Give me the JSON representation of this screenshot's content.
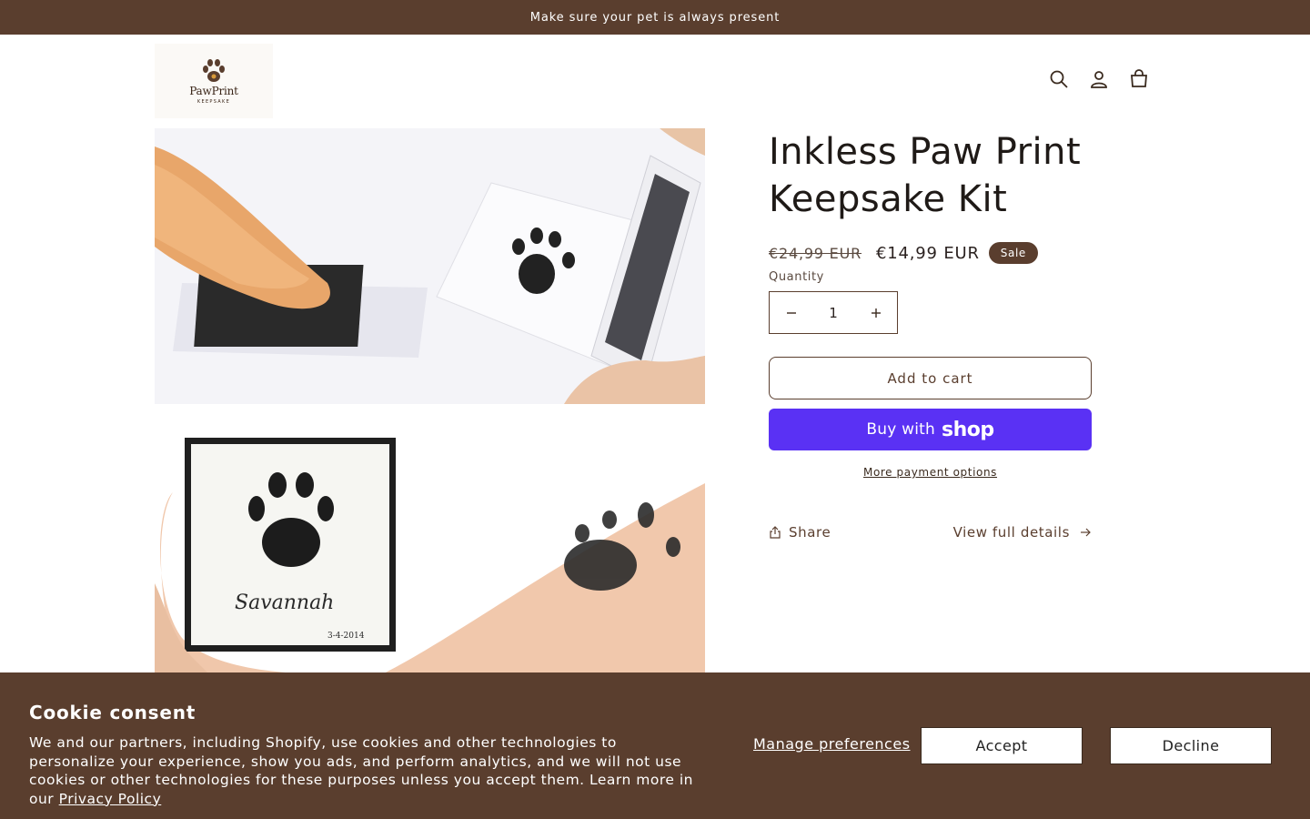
{
  "announcement": {
    "text": "Make sure your pet is always present"
  },
  "header": {
    "logo": {
      "name": "PawPrint",
      "subtitle": "KEEPSAKE"
    },
    "icons": [
      "search-icon",
      "account-icon",
      "cart-icon"
    ]
  },
  "gallery": {
    "image_text": {
      "name": "Savannah",
      "date": "3-4-2014"
    }
  },
  "product": {
    "title": "Inkless Paw Print Keepsake Kit",
    "price_regular": "€24,99 EUR",
    "price_sale": "€14,99 EUR",
    "badge": "Sale",
    "quantity_label": "Quantity",
    "quantity_value": "1",
    "add_to_cart": "Add to cart",
    "buy_with": "Buy with",
    "shop_brand": "shop",
    "more_payment": "More payment options",
    "share": "Share",
    "view_details": "View full details"
  },
  "cookie": {
    "title": "Cookie consent",
    "text": "We and our partners, including Shopify, use cookies and other technologies to personalize your experience, show you ads, and perform analytics, and we will not use cookies or other technologies for these purposes unless you accept them. Learn more in our",
    "link": "Privacy Policy",
    "manage": "Manage preferences",
    "accept": "Accept",
    "decline": "Decline"
  },
  "colors": {
    "brand_brown": "#5a3e2e",
    "shop_purple": "#5a31f4",
    "background": "#ffffff"
  }
}
